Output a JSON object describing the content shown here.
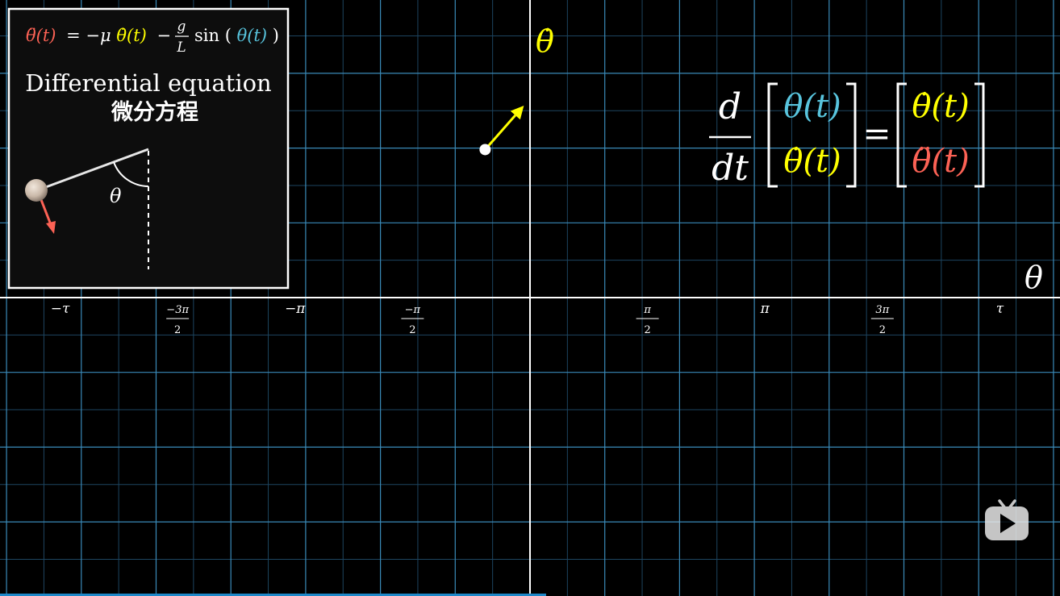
{
  "equation_panel": {
    "equation": {
      "lhs": "θ̈(t)",
      "eq": "= −μ",
      "damp": "θ̇(t)",
      "minus": "−",
      "frac_num": "g",
      "frac_den": "L",
      "sin_open": "sin (",
      "sin_arg": "θ(t)",
      "sin_close": ")"
    },
    "title_en": "Differential equation",
    "title_zh": "微分方程",
    "pendulum_angle_label": "θ"
  },
  "axes": {
    "x_label": "θ",
    "y_label": "θ̇",
    "x_ticks": [
      {
        "value": -6.2832,
        "num": "−τ",
        "den": ""
      },
      {
        "value": -4.7124,
        "num": "−3π",
        "den": "2"
      },
      {
        "value": -3.1416,
        "num": "−π",
        "den": ""
      },
      {
        "value": -1.5708,
        "num": "−π",
        "den": "2"
      },
      {
        "value": 1.5708,
        "num": "π",
        "den": "2"
      },
      {
        "value": 3.1416,
        "num": "π",
        "den": ""
      },
      {
        "value": 4.7124,
        "num": "3π",
        "den": "2"
      },
      {
        "value": 6.2832,
        "num": "τ",
        "den": ""
      }
    ]
  },
  "state_point": {
    "theta": -0.6,
    "theta_dot": 1.98
  },
  "state_vector": {
    "d_theta": 0.74,
    "d_theta_dot": 0.84
  },
  "matrix_equation": {
    "d_num": "d",
    "d_den": "dt",
    "left_top": "θ(t)",
    "left_bottom": "θ̇(t)",
    "equals": "=",
    "right_top": "θ̇(t)",
    "right_bottom": "θ̈(t)"
  },
  "player": {
    "logo_icon": "bilibili-tv-icon",
    "progress": 0.515
  },
  "colors": {
    "background": "#000000",
    "grid_major": "#3a8ab8",
    "grid_minor": "#1d4560",
    "axis": "#ffffff",
    "theta_blue": "#58c4dd",
    "theta_dot_yellow": "#ffff00",
    "theta_ddot_red": "#fc6255",
    "progress_blue": "#1e88c8"
  }
}
